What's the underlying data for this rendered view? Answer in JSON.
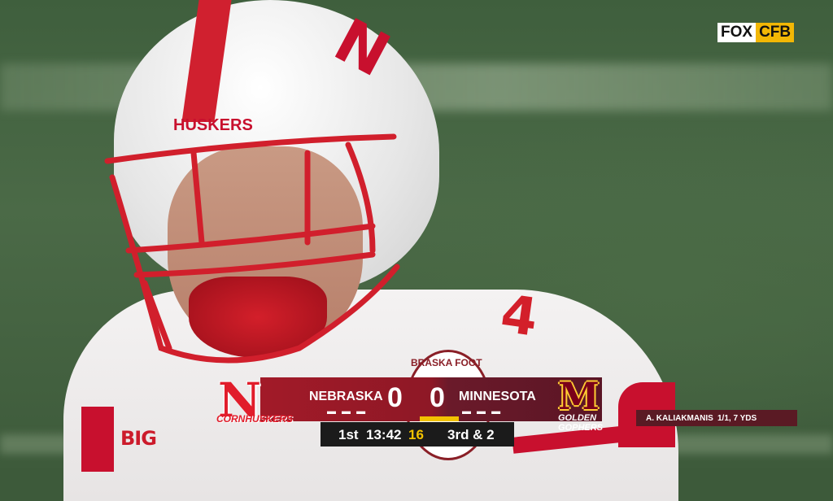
{
  "network": {
    "fox": "FOX",
    "cfb": "CFB"
  },
  "player": {
    "helmet_text": "HUSKERS",
    "helmet_letter": "N",
    "jersey_number": "4",
    "sleeve_logo": "BIG",
    "patch_text": "BRASKA FOOT"
  },
  "scorebug": {
    "home": {
      "logo_letter": "N",
      "logo_sub": "CORNHUSKERS",
      "name": "NEBRASKA",
      "score": "0",
      "timeouts": "▬ ▬ ▬"
    },
    "away": {
      "logo_letter": "M",
      "logo_sub": "GOLDEN GOPHERS",
      "name": "MINNESOTA",
      "score": "0",
      "timeouts": "▬ ▬ ▬"
    },
    "quarter": "1st",
    "clock": "13:42",
    "play_clock": "16",
    "down_distance": "3rd & 2",
    "colors": {
      "home": "#a21a28",
      "away": "#5a1525",
      "flag": "#f2c200"
    }
  },
  "stat_ticker": {
    "player": "A. KALIAKMANIS",
    "line": "1/1, 7 YDS"
  }
}
